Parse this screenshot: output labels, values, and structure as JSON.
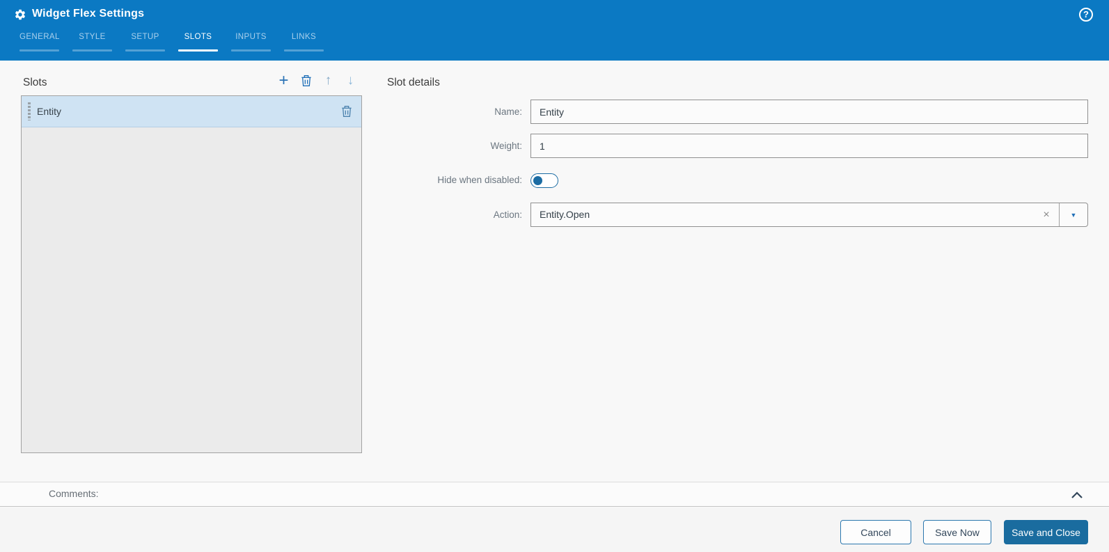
{
  "colors": {
    "header_bg": "#0b79c3",
    "selection_bg": "#cfe3f3",
    "accent_blue": "#2170b8",
    "toggle_blue": "#1b6ca3",
    "primary_button_bg": "#1a6c9f"
  },
  "header": {
    "title": "Widget Flex Settings",
    "help_glyph": "?",
    "tabs": [
      {
        "label": "GENERAL",
        "active": false
      },
      {
        "label": "STYLE",
        "active": false
      },
      {
        "label": "SETUP",
        "active": false
      },
      {
        "label": "SLOTS",
        "active": true
      },
      {
        "label": "INPUTS",
        "active": false
      },
      {
        "label": "LINKS",
        "active": false
      }
    ]
  },
  "slots_panel": {
    "title": "Slots",
    "toolbar": {
      "add_glyph": "+",
      "delete_icon": "trash-icon",
      "move_up_glyph": "↑",
      "move_down_glyph": "↓"
    },
    "items": [
      {
        "label": "Entity",
        "selected": true
      }
    ]
  },
  "details_panel": {
    "title": "Slot details",
    "name": {
      "label": "Name:",
      "value": "Entity"
    },
    "weight": {
      "label": "Weight:",
      "value": "1"
    },
    "hide_when_disabled": {
      "label": "Hide when disabled:",
      "state": "off"
    },
    "action": {
      "label": "Action:",
      "value": "Entity.Open",
      "clear_glyph": "×",
      "caret_glyph": "▼"
    }
  },
  "comments": {
    "label": "Comments:"
  },
  "footer": {
    "cancel_label": "Cancel",
    "save_now_label": "Save Now",
    "save_close_label": "Save and Close"
  }
}
